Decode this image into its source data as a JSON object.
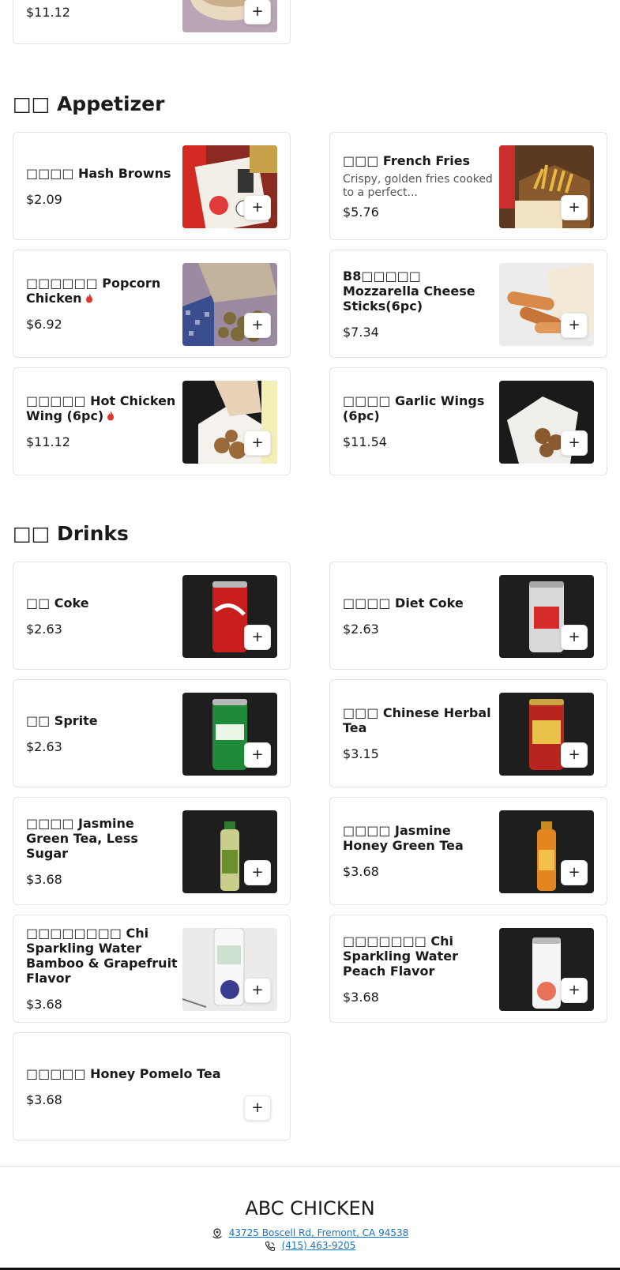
{
  "top_partial": {
    "price": "$11.12",
    "add_label": "+"
  },
  "sections": {
    "appetizer": {
      "title": "□□ Appetizer",
      "items": [
        {
          "name": "□□□□ Hash Browns",
          "price": "$2.09",
          "add": "+"
        },
        {
          "name": "□□□ French Fries",
          "desc": "Crispy, golden fries cooked to a perfect...",
          "price": "$5.76",
          "add": "+"
        },
        {
          "name": "□□□□□□ Popcorn Chicken",
          "spicy": true,
          "price": "$6.92",
          "add": "+"
        },
        {
          "name": "B8□□□□□ Mozzarella Cheese Sticks(6pc)",
          "price": "$7.34",
          "add": "+"
        },
        {
          "name": "□□□□□ Hot Chicken Wing (6pc)",
          "spicy": true,
          "price": "$11.12",
          "add": "+"
        },
        {
          "name": "□□□□ Garlic Wings (6pc)",
          "price": "$11.54",
          "add": "+"
        }
      ]
    },
    "drinks": {
      "title": "□□ Drinks",
      "items": [
        {
          "name": "□□ Coke",
          "price": "$2.63",
          "add": "+"
        },
        {
          "name": "□□□□ Diet Coke",
          "price": "$2.63",
          "add": "+"
        },
        {
          "name": "□□ Sprite",
          "price": "$2.63",
          "add": "+"
        },
        {
          "name": "□□□ Chinese Herbal Tea",
          "price": "$3.15",
          "add": "+"
        },
        {
          "name": "□□□□ Jasmine Green Tea, Less Sugar",
          "price": "$3.68",
          "add": "+"
        },
        {
          "name": "□□□□ Jasmine Honey Green Tea",
          "price": "$3.68",
          "add": "+"
        },
        {
          "name": "□□□□□□□□ Chi Sparkling Water Bamboo & Grapefruit Flavor",
          "price": "$3.68",
          "add": "+"
        },
        {
          "name": "□□□□□□□ Chi Sparkling Water Peach Flavor",
          "price": "$3.68",
          "add": "+"
        },
        {
          "name": "□□□□□ Honey Pomelo Tea",
          "price": "$3.68",
          "add": "+"
        }
      ]
    }
  },
  "footer": {
    "brand": "ABC CHICKEN",
    "address": "43725 Boscell Rd, Fremont, CA 94538",
    "phone": "(415) 463-9205",
    "link_color": "#1a73c8"
  },
  "icons": {
    "spicy": "fire-icon",
    "address": "map-pin-icon",
    "phone": "phone-icon"
  }
}
